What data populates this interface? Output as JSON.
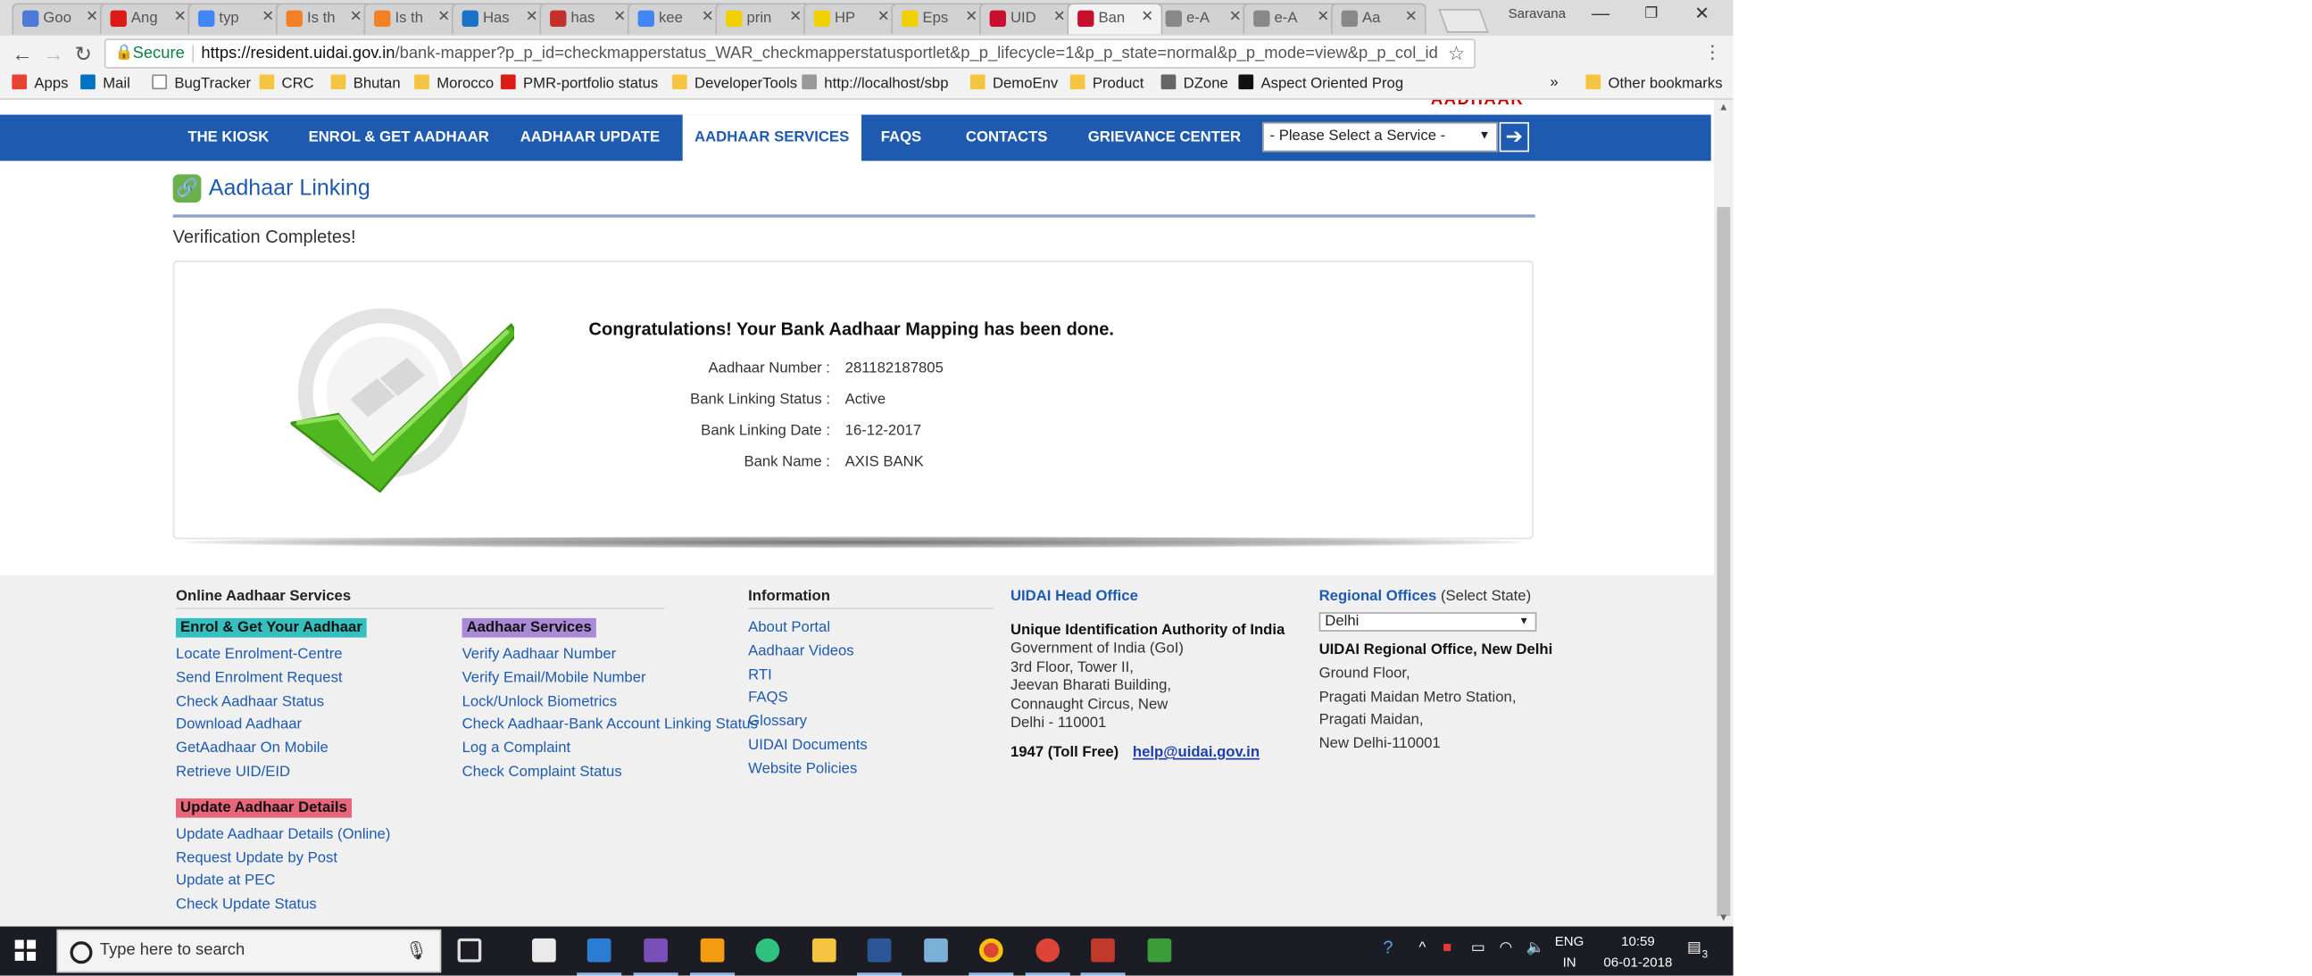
{
  "browser": {
    "tabs": [
      {
        "label": "Goo",
        "color": "#4a7bd6"
      },
      {
        "label": "Ang",
        "color": "#dd1b16"
      },
      {
        "label": "typ",
        "color": "#4285f4"
      },
      {
        "label": "Is th",
        "color": "#f48024"
      },
      {
        "label": "Is th",
        "color": "#f48024"
      },
      {
        "label": "Has",
        "color": "#1a73c7"
      },
      {
        "label": "has",
        "color": "#c4302b"
      },
      {
        "label": "kee",
        "color": "#4285f4"
      },
      {
        "label": "prin",
        "color": "#f0d000"
      },
      {
        "label": "HP",
        "color": "#f0d000"
      },
      {
        "label": "Eps",
        "color": "#f0d000"
      },
      {
        "label": "UID",
        "color": "#c8102e"
      },
      {
        "label": "Ban",
        "color": "#c8102e",
        "active": true
      },
      {
        "label": "e-A",
        "color": "#888888"
      },
      {
        "label": "e-A",
        "color": "#888888"
      },
      {
        "label": "Aa",
        "color": "#888888"
      }
    ],
    "profile_name": "Saravana",
    "secure_label": "Secure",
    "url_host": "https://resident.uidai.gov.in",
    "url_path": "/bank-mapper?p_p_id=checkmapperstatus_WAR_checkmapperstatusportlet&p_p_lifecycle=1&p_p_state=normal&p_p_mode=view&p_p_col_id=colu...",
    "bookmarks": [
      {
        "label": "Apps",
        "color": "#e94235"
      },
      {
        "label": "Mail",
        "color": "#0072c6"
      },
      {
        "label": "BugTracker",
        "color": "#ffffff"
      },
      {
        "label": "CRC",
        "color": "#f5c542"
      },
      {
        "label": "Bhutan",
        "color": "#f5c542"
      },
      {
        "label": "Morocco",
        "color": "#f5c542"
      },
      {
        "label": "PMR-portfolio status",
        "color": "#dd1b16"
      },
      {
        "label": "DeveloperTools",
        "color": "#f5c542"
      },
      {
        "label": "http://localhost/sbp",
        "color": "#999999"
      },
      {
        "label": "DemoEnv",
        "color": "#f5c542"
      },
      {
        "label": "Product",
        "color": "#f5c542"
      },
      {
        "label": "DZone",
        "color": "#666666"
      },
      {
        "label": "Aspect Oriented Prog",
        "color": "#111111"
      }
    ],
    "more_bookmarks": "»",
    "other_bookmarks": "Other bookmarks"
  },
  "site": {
    "nav": [
      "THE KIOSK",
      "ENROL & GET AADHAAR",
      "AADHAAR UPDATE",
      "AADHAAR SERVICES",
      "FAQS",
      "CONTACTS",
      "GRIEVANCE CENTER"
    ],
    "active_nav": "AADHAAR SERVICES",
    "service_select": "- Please Select a Service -",
    "go_arrow": "➔",
    "page_title": "Aadhaar Linking",
    "verification_text": "Verification Completes!",
    "congrats": "Congratulations! Your Bank Aadhaar Mapping has been done.",
    "details": [
      {
        "label": "Aadhaar Number :",
        "value": "281182187805"
      },
      {
        "label": "Bank Linking Status :",
        "value": "Active"
      },
      {
        "label": "Bank Linking Date :",
        "value": "16-12-2017"
      },
      {
        "label": "Bank Name :",
        "value": "AXIS BANK"
      }
    ]
  },
  "footer": {
    "online_services_title": "Online Aadhaar Services",
    "enrol_badge": "Enrol & Get Your Aadhaar",
    "enrol_links": [
      "Locate Enrolment-Centre",
      "Send Enrolment Request",
      "Check Aadhaar Status",
      "Download Aadhaar",
      "GetAadhaar On Mobile",
      "Retrieve UID/EID"
    ],
    "services_badge": "Aadhaar Services",
    "services_links": [
      "Verify Aadhaar Number",
      "Verify Email/Mobile Number",
      "Lock/Unlock Biometrics",
      "Check Aadhaar-Bank Account Linking Status",
      "Log a Complaint",
      "Check Complaint Status"
    ],
    "update_badge": "Update Aadhaar Details",
    "update_links": [
      "Update Aadhaar Details (Online)",
      "Request Update by Post",
      "Update at PEC",
      "Check Update Status"
    ],
    "information_title": "Information",
    "information_links": [
      "About Portal",
      "Aadhaar Videos",
      "RTI",
      "FAQS",
      "Glossary",
      "UIDAI Documents",
      "Website Policies"
    ],
    "head_office_title": "UIDAI Head Office",
    "head_office_org": "Unique Identification Authority of India",
    "head_office_lines": [
      "Government of India (GoI)",
      "3rd Floor, Tower II,",
      "Jeevan Bharati Building,",
      "Connaught Circus, New",
      "Delhi - 110001"
    ],
    "toll_free": "1947 (Toll Free)",
    "email": "help@uidai.gov.in",
    "regional_title": "Regional Offices",
    "regional_hint": "(Select State)",
    "state_select": "Delhi",
    "regional_office_name": "UIDAI Regional Office, New Delhi",
    "regional_lines": [
      "Ground Floor,",
      "Pragati Maidan Metro Station,",
      "Pragati Maidan,",
      "New Delhi-110001"
    ]
  },
  "taskbar": {
    "search_placeholder": "Type here to search",
    "lang_line1": "ENG",
    "lang_line2": "IN",
    "time": "10:59",
    "date": "06-01-2018",
    "notifications": "3"
  }
}
